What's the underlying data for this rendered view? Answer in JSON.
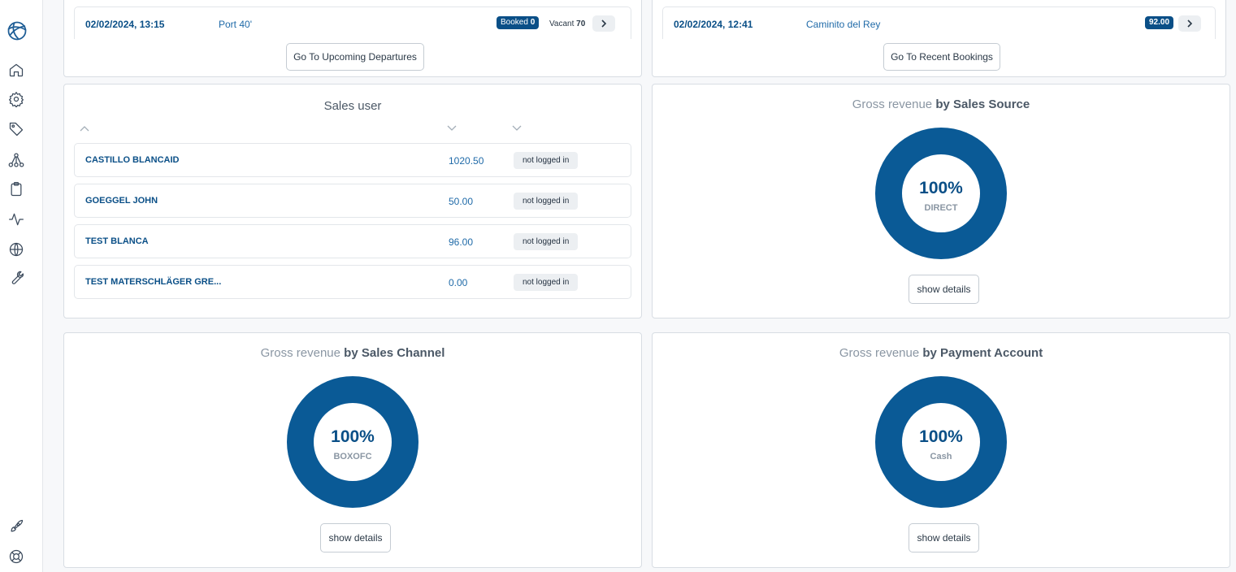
{
  "sidebar": {
    "logo": "globe-logo-icon",
    "items": [
      "home-icon",
      "settings-gear-icon",
      "tag-icon",
      "network-icon",
      "clipboard-icon",
      "activity-icon",
      "globe-icon",
      "wrench-icon"
    ],
    "bottom": [
      "rocket-icon",
      "lifebuoy-icon"
    ]
  },
  "departures": {
    "row": {
      "date": "02/02/2024, 13:15",
      "name": "Port 40'",
      "booked_label": "Booked",
      "booked_value": "0",
      "vacant_label": "Vacant",
      "vacant_value": "70"
    },
    "button": "Go To Upcoming Departures"
  },
  "bookings": {
    "row": {
      "date": "02/02/2024, 12:41",
      "name": "Caminito del Rey",
      "amount": "92.00"
    },
    "button": "Go To Recent Bookings"
  },
  "sales_user": {
    "title": "Sales user",
    "rows": [
      {
        "name": "CASTILLO BLANCAID",
        "amount": "1020.50",
        "status": "not logged in"
      },
      {
        "name": "GOEGGEL JOHN",
        "amount": "50.00",
        "status": "not logged in"
      },
      {
        "name": "TEST BLANCA",
        "amount": "96.00",
        "status": "not logged in"
      },
      {
        "name": "TEST MATERSCHLÄGER GRE...",
        "amount": "0.00",
        "status": "not logged in"
      }
    ]
  },
  "revenue_source": {
    "title_prefix": "Gross revenue",
    "title_suffix": "by Sales Source",
    "percent": "100%",
    "label": "DIRECT",
    "button": "show details"
  },
  "revenue_channel": {
    "title_prefix": "Gross revenue",
    "title_suffix": "by Sales Channel",
    "percent": "100%",
    "label": "BOXOFC",
    "button": "show details"
  },
  "revenue_payment": {
    "title_prefix": "Gross revenue",
    "title_suffix": "by Payment Account",
    "percent": "100%",
    "label": "Cash",
    "button": "show details"
  },
  "colors": {
    "accent": "#0a5a96",
    "accent_dark": "#0a4f87",
    "muted": "#8a96a3"
  }
}
